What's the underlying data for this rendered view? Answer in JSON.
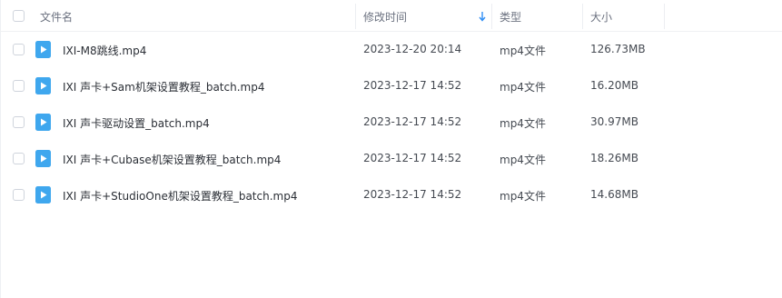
{
  "header": {
    "name_label": "文件名",
    "modified_label": "修改时间",
    "type_label": "类型",
    "size_label": "大小",
    "sort_icon": "arrow-down-icon"
  },
  "files": [
    {
      "name": "IXI-M8跳线.mp4",
      "modified": "2023-12-20 20:14",
      "type": "mp4文件",
      "size": "126.73MB",
      "icon": "video-file-icon"
    },
    {
      "name": "IXI 声卡+Sam机架设置教程_batch.mp4",
      "modified": "2023-12-17 14:52",
      "type": "mp4文件",
      "size": "16.20MB",
      "icon": "video-file-icon"
    },
    {
      "name": "IXI 声卡驱动设置_batch.mp4",
      "modified": "2023-12-17 14:52",
      "type": "mp4文件",
      "size": "30.97MB",
      "icon": "video-file-icon"
    },
    {
      "name": "IXI 声卡+Cubase机架设置教程_batch.mp4",
      "modified": "2023-12-17 14:52",
      "type": "mp4文件",
      "size": "18.26MB",
      "icon": "video-file-icon"
    },
    {
      "name": "IXI 声卡+StudioOne机架设置教程_batch.mp4",
      "modified": "2023-12-17 14:52",
      "type": "mp4文件",
      "size": "14.68MB",
      "icon": "video-file-icon"
    }
  ],
  "colors": {
    "file_icon": "#3fa7ee",
    "sort_arrow": "#2f8ef5"
  }
}
